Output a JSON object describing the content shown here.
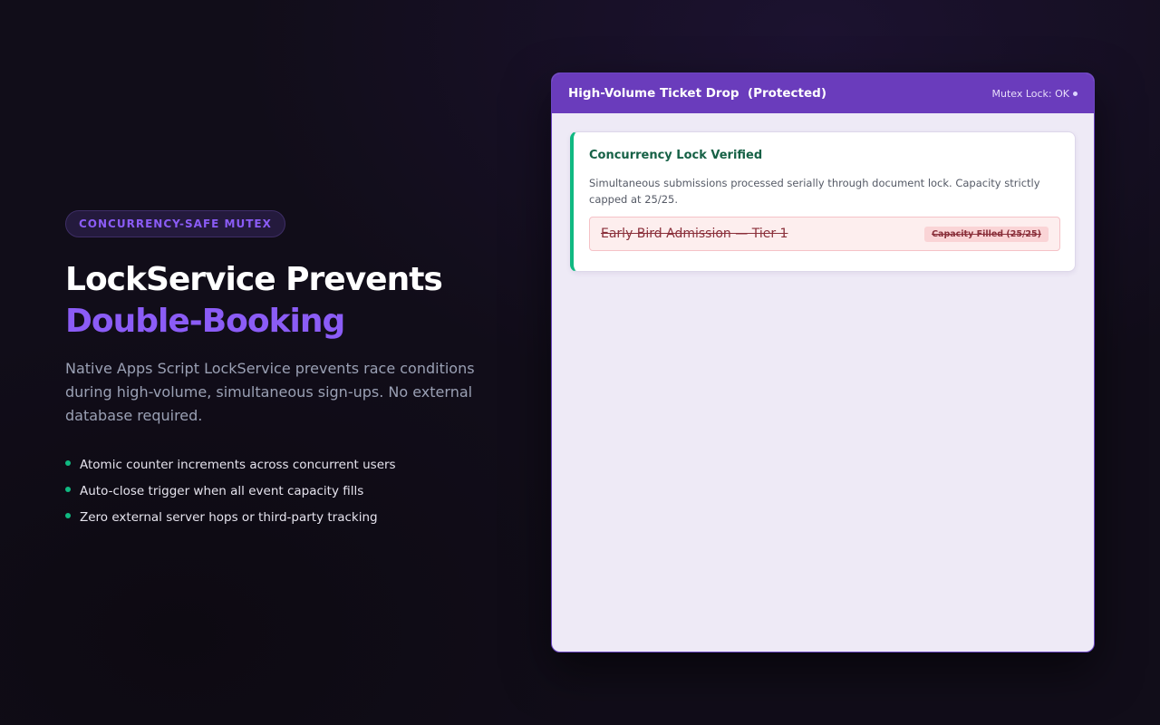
{
  "hero": {
    "pill": "CONCURRENCY-SAFE MUTEX",
    "headline_line1": "LockService Prevents",
    "headline_line2": "Double-Booking",
    "lede": "Native Apps Script LockService prevents race conditions during high-volume, simultaneous sign-ups. No external database required.",
    "bullets": [
      "Atomic counter increments across concurrent users",
      "Auto-close trigger when all event capacity fills",
      "Zero external server hops or third-party tracking"
    ]
  },
  "panel": {
    "title": "High-Volume Ticket Drop  (Protected)",
    "status": "Mutex Lock: OK",
    "card": {
      "title": "Concurrency Lock Verified",
      "body": "Simultaneous submissions processed serially through document lock. Capacity strictly capped at 25/25.",
      "tier_name": "Early Bird Admission — Tier 1",
      "tier_badge": "Capacity Filled (25/25)"
    }
  },
  "colors": {
    "accent": "#8b5cf6",
    "header": "#6a3cbc",
    "success": "#10b981",
    "danger": "#8a2f3a"
  }
}
